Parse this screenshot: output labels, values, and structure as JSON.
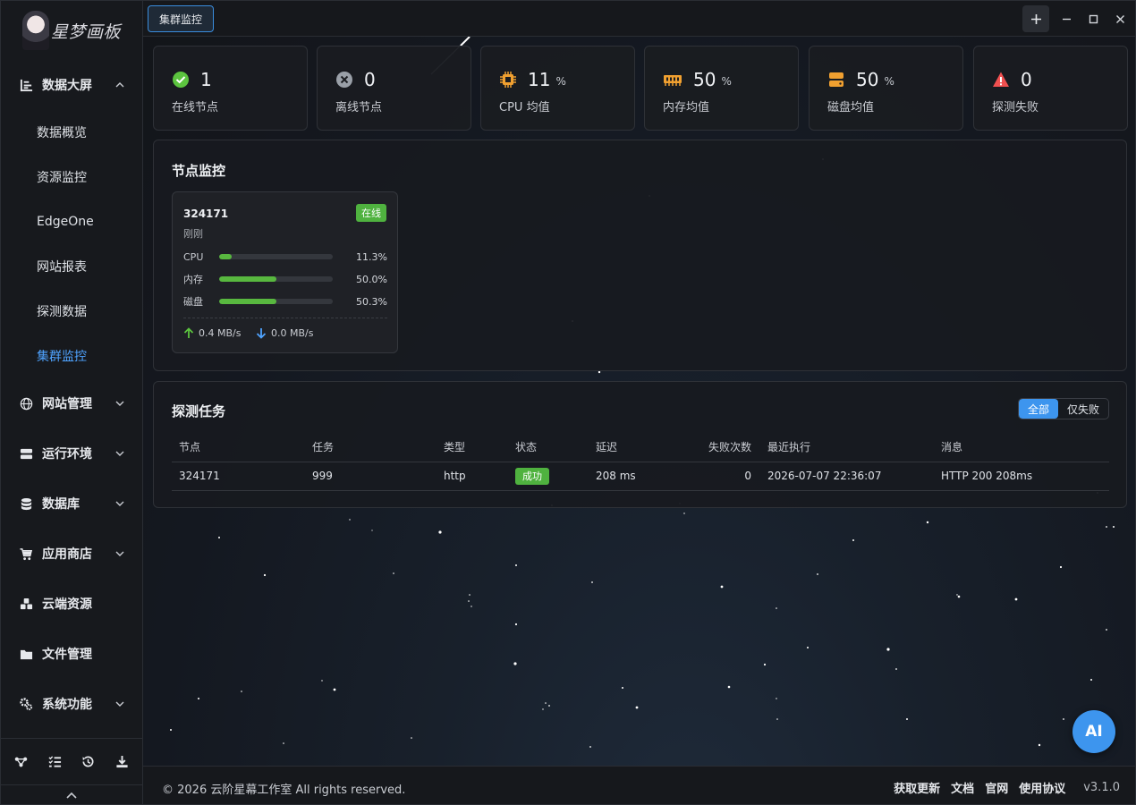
{
  "brand": {
    "logo_text": "星梦画板"
  },
  "sidebar": {
    "groups": [
      {
        "label": "数据大屏",
        "icon": "chart-bar-icon",
        "expanded": true
      },
      {
        "label": "网站管理",
        "icon": "globe-icon"
      },
      {
        "label": "运行环境",
        "icon": "server-icon"
      },
      {
        "label": "数据库",
        "icon": "database-icon"
      },
      {
        "label": "应用商店",
        "icon": "cart-icon"
      },
      {
        "label": "云端资源",
        "icon": "cloud-cubes-icon"
      },
      {
        "label": "文件管理",
        "icon": "folder-icon"
      },
      {
        "label": "系统功能",
        "icon": "gears-icon"
      }
    ],
    "sub_items": [
      {
        "label": "数据概览"
      },
      {
        "label": "资源监控"
      },
      {
        "label": "EdgeOne"
      },
      {
        "label": "网站报表"
      },
      {
        "label": "探测数据"
      },
      {
        "label": "集群监控",
        "active": true
      }
    ],
    "tools": [
      "share-nodes-icon",
      "list-check-icon",
      "history-icon",
      "download-icon"
    ]
  },
  "topbar": {
    "active_tab": "集群监控"
  },
  "stats": [
    {
      "value": "1",
      "unit": "",
      "label": "在线节点",
      "icon": "check-circle-icon",
      "color": "#5cc43f"
    },
    {
      "value": "0",
      "unit": "",
      "label": "离线节点",
      "icon": "x-circle-icon",
      "color": "#9aa0a8"
    },
    {
      "value": "11",
      "unit": "%",
      "label": "CPU 均值",
      "icon": "cpu-icon",
      "color": "#f0a030"
    },
    {
      "value": "50",
      "unit": "%",
      "label": "内存均值",
      "icon": "memory-icon",
      "color": "#f0a030"
    },
    {
      "value": "50",
      "unit": "%",
      "label": "磁盘均值",
      "icon": "disk-icon",
      "color": "#f0a030"
    },
    {
      "value": "0",
      "unit": "",
      "label": "探测失败",
      "icon": "warning-icon",
      "color": "#f05050"
    }
  ],
  "node_panel": {
    "title": "节点监控",
    "nodes": [
      {
        "name": "324171",
        "status": "在线",
        "updated": "刚刚",
        "metrics": [
          {
            "label": "CPU",
            "value": "11.3%",
            "fraction": 0.113
          },
          {
            "label": "内存",
            "value": "50.0%",
            "fraction": 0.5
          },
          {
            "label": "磁盘",
            "value": "50.3%",
            "fraction": 0.503
          }
        ],
        "upload": "0.4 MB/s",
        "download": "0.0 MB/s"
      }
    ]
  },
  "task_panel": {
    "title": "探测任务",
    "filters": [
      "全部",
      "仅失败"
    ],
    "active_filter": "全部",
    "columns": [
      "节点",
      "任务",
      "类型",
      "状态",
      "延迟",
      "失败次数",
      "最近执行",
      "消息"
    ],
    "rows": [
      {
        "node": "324171",
        "task": "999",
        "type": "http",
        "status": "成功",
        "latency": "208 ms",
        "failures": "0",
        "last_run": "2026-07-07 22:36:07",
        "message": "HTTP 200 208ms"
      }
    ]
  },
  "footer": {
    "copyright": "© 2026 云阶星幕工作室 All rights reserved.",
    "links": [
      "获取更新",
      "文档",
      "官网",
      "使用协议"
    ],
    "version": "v3.1.0"
  },
  "ai_button": {
    "label": "AI"
  },
  "colors": {
    "accent": "#3d95ee",
    "success": "#4fb23f",
    "warning": "#f0a030",
    "danger": "#f05050"
  }
}
